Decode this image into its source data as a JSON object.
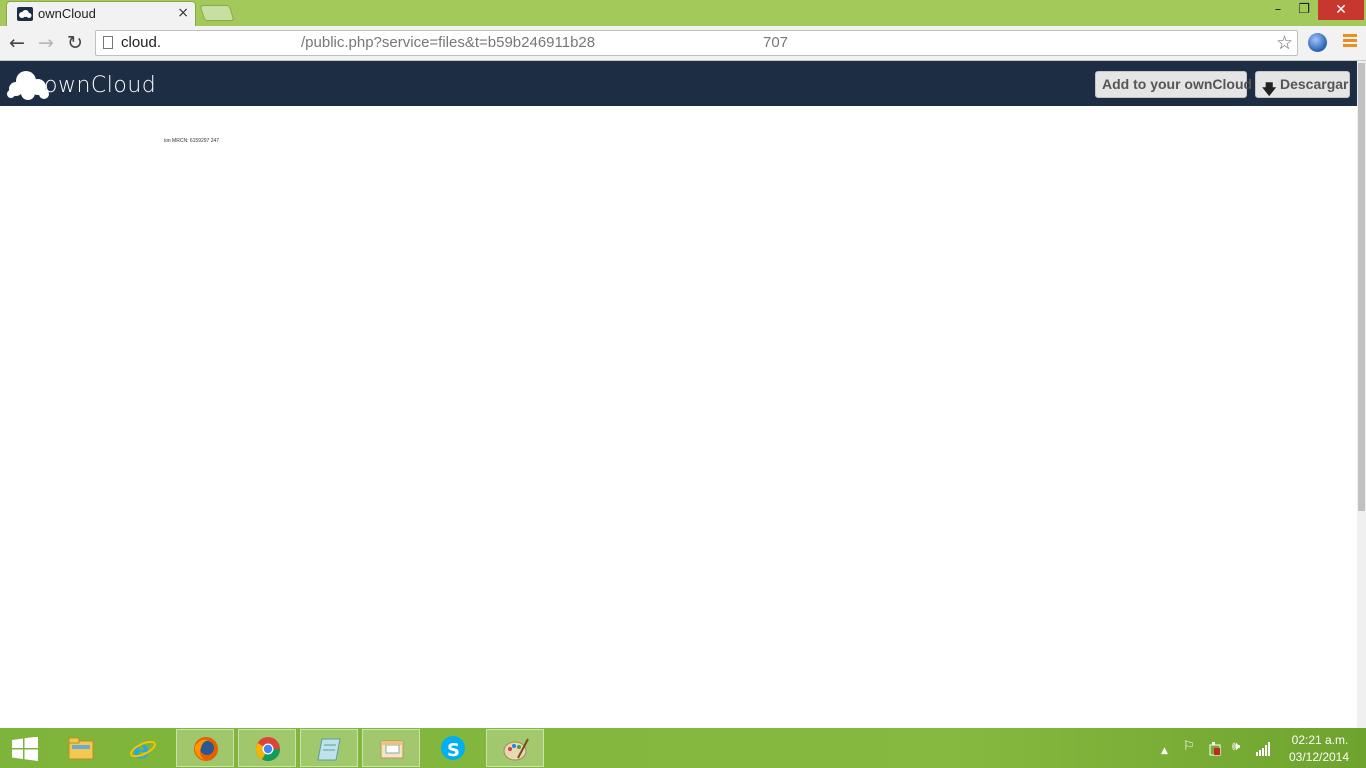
{
  "browser": {
    "tab_title": "ownCloud",
    "tab_close": "×",
    "window_min": "–",
    "window_max": "❐",
    "window_close": "✕",
    "nav_back": "←",
    "nav_forward": "→",
    "nav_reload": "↻",
    "url_host": "cloud.",
    "url_path": "/public.php?service=files&t=b59b246911b28",
    "url_tail": "707",
    "bookmark_star": "☆"
  },
  "owncloud": {
    "logo_text": "ownCloud",
    "add_button_label": "Add to your ownCloud",
    "download_button_label": "Descargar",
    "download_icon": "🡇",
    "preview_text": "ion MRCN: 6159297 247"
  },
  "taskbar": {
    "apps": [
      {
        "name": "file-explorer-icon",
        "active": false
      },
      {
        "name": "internet-explorer-icon",
        "active": false
      },
      {
        "name": "firefox-icon",
        "active": true
      },
      {
        "name": "chrome-icon",
        "active": true
      },
      {
        "name": "notes-icon",
        "active": true
      },
      {
        "name": "mail-icon",
        "active": true
      },
      {
        "name": "skype-icon",
        "active": false
      },
      {
        "name": "paint-icon",
        "active": true
      }
    ],
    "tray_arrow": "▲",
    "tray_flag": "⚐",
    "tray_volume": "🕪",
    "clock_time": "02:21 a.m.",
    "clock_date": "03/12/2014"
  },
  "colors": {
    "tab_strip": "#a3c95a",
    "owncloud_header": "#1d2d44",
    "taskbar": "#86b93f",
    "close_button": "#c7372f"
  }
}
